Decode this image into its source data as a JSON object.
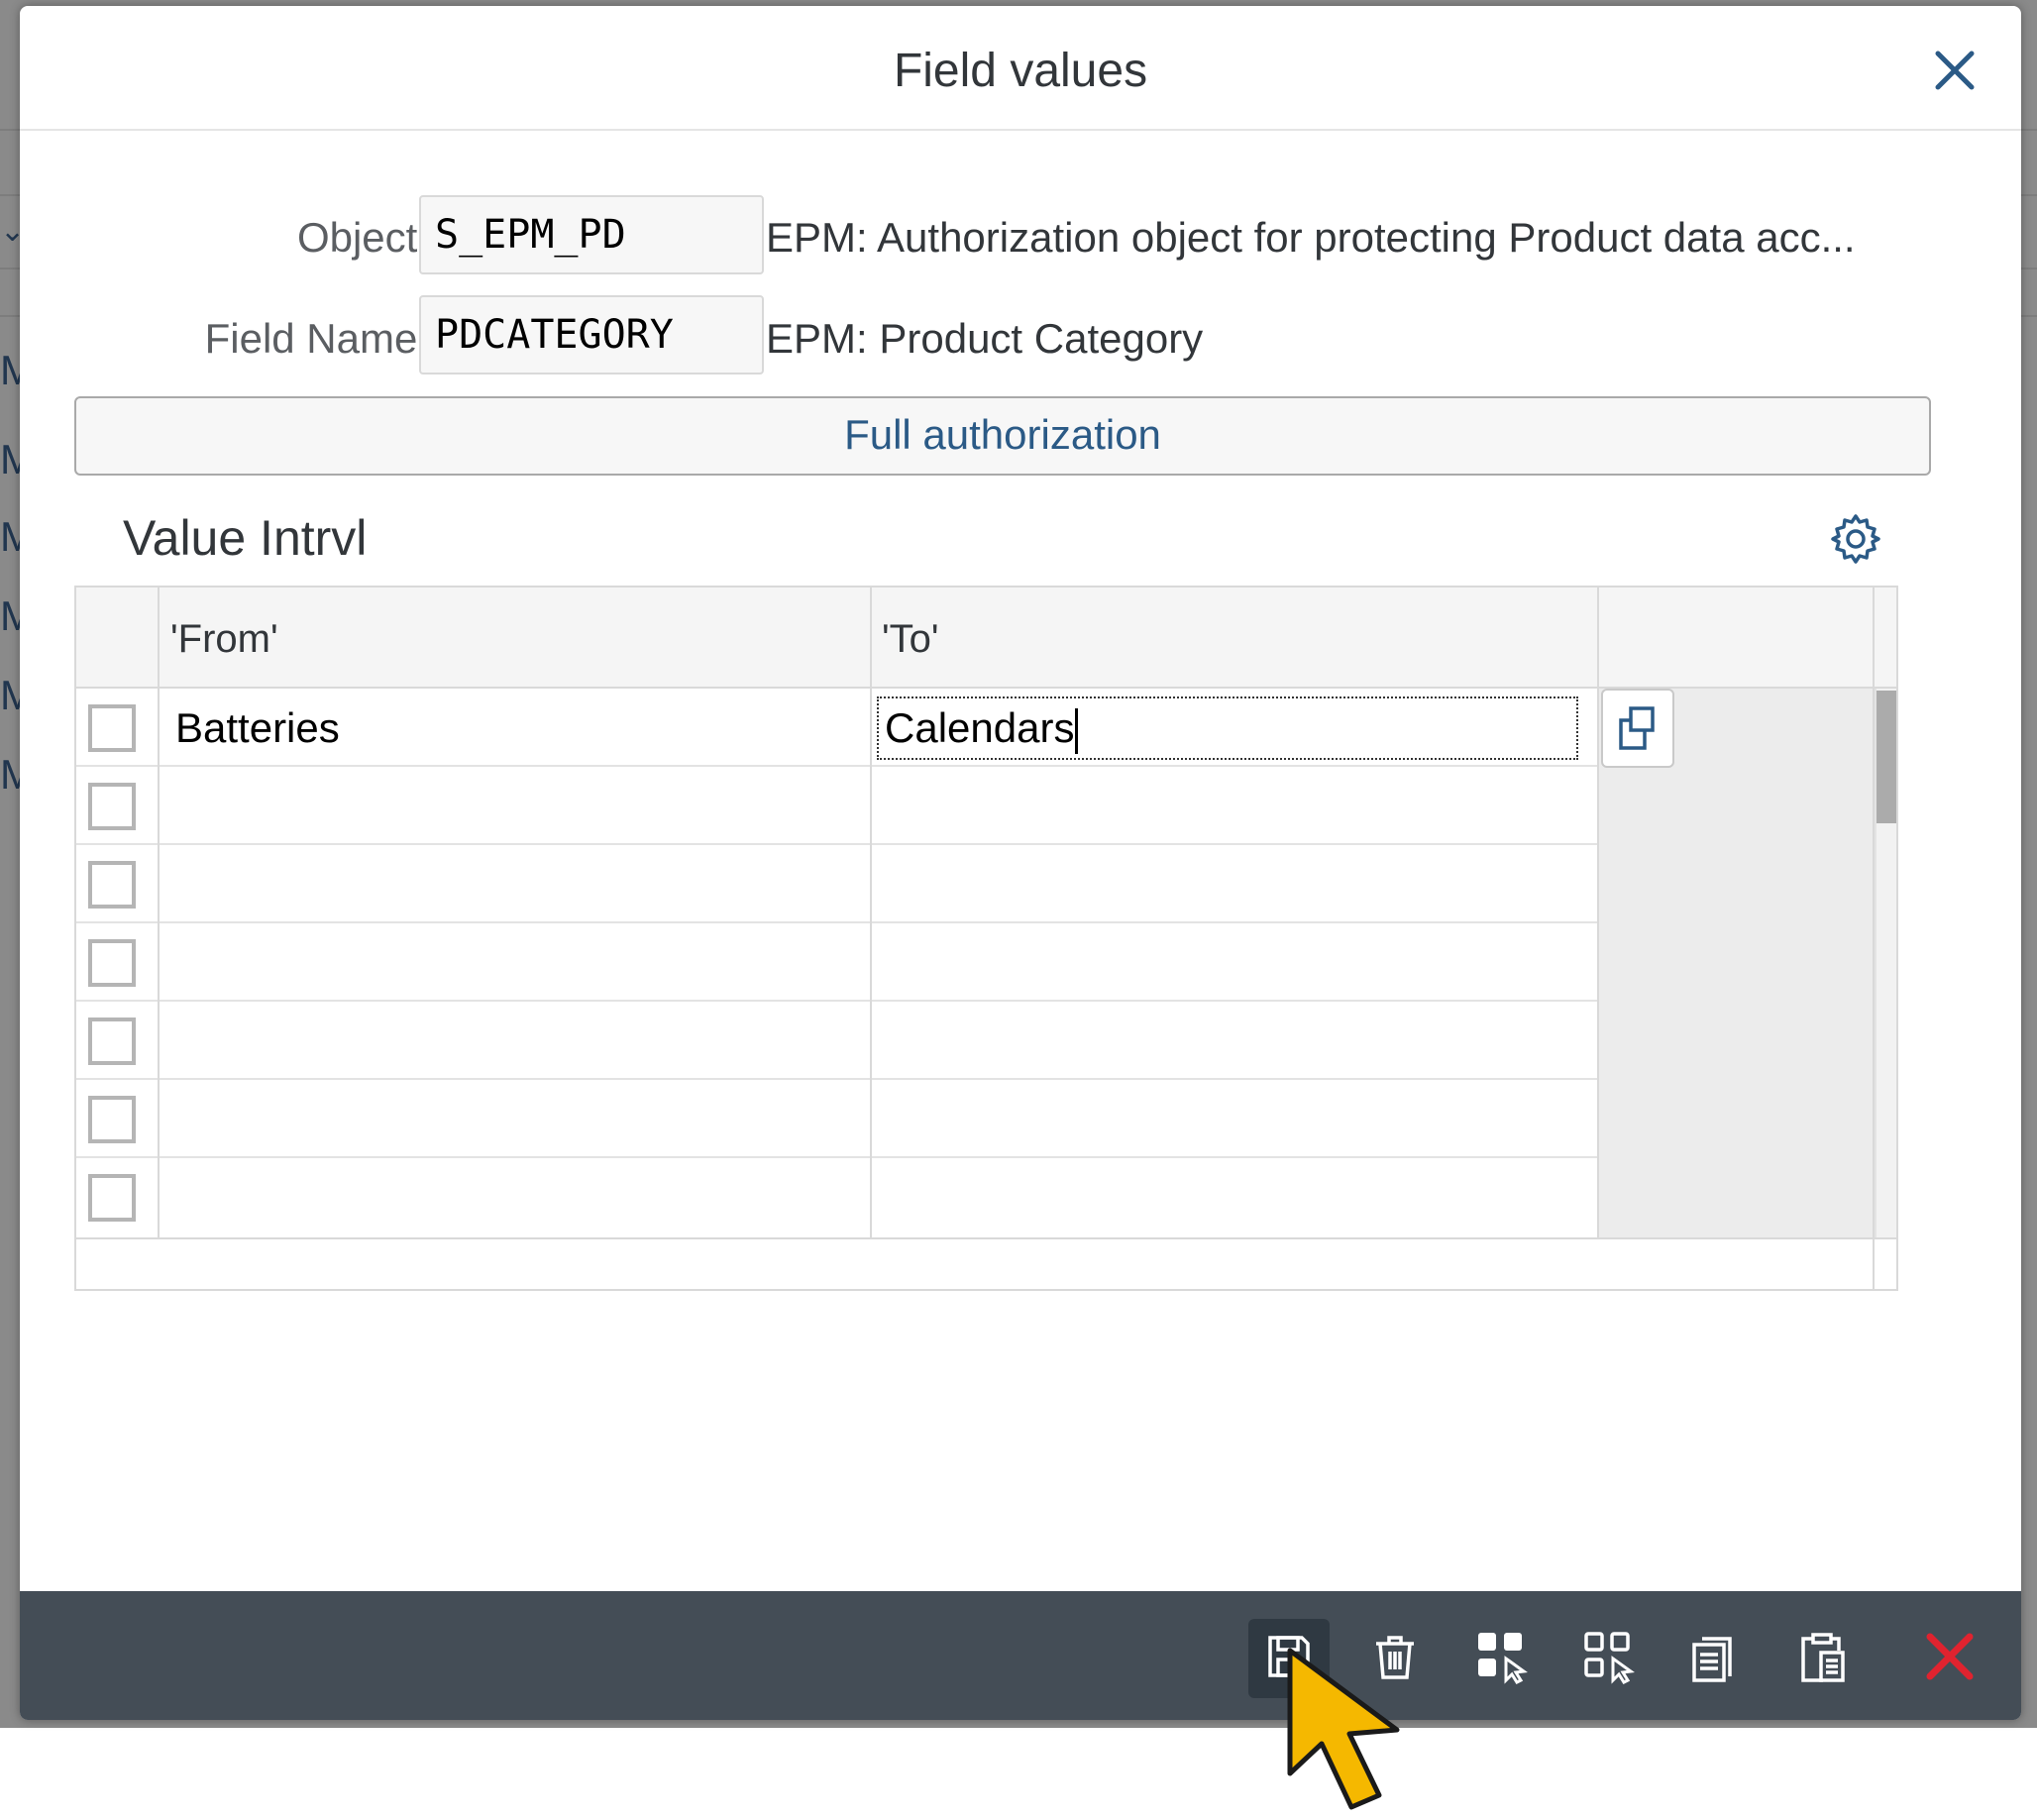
{
  "dialog": {
    "title": "Field values"
  },
  "object": {
    "label": "Object:",
    "value": "S_EPM_PD",
    "description": "EPM: Authorization object for protecting Product data acc..."
  },
  "field_name": {
    "label": "Field Name:",
    "value": "PDCATEGORY",
    "description": "EPM: Product Category"
  },
  "full_authorization_label": "Full authorization",
  "value_interval": {
    "title": "Value Intrvl",
    "columns": [
      "'From'",
      "'To'"
    ],
    "rows": [
      {
        "from": "Batteries",
        "to": "Calendars"
      },
      {
        "from": "",
        "to": ""
      },
      {
        "from": "",
        "to": ""
      },
      {
        "from": "",
        "to": ""
      },
      {
        "from": "",
        "to": ""
      },
      {
        "from": "",
        "to": ""
      },
      {
        "from": "",
        "to": ""
      }
    ]
  },
  "toolbar": {
    "icons": [
      "save-icon",
      "delete-icon",
      "select-all-icon",
      "deselect-all-icon",
      "copy-icon",
      "paste-icon",
      "cancel-icon"
    ]
  },
  "colors": {
    "accent": "#2b5a86",
    "footer": "#444d56",
    "cancel": "#e0232f",
    "cursor": "#f5b800"
  }
}
